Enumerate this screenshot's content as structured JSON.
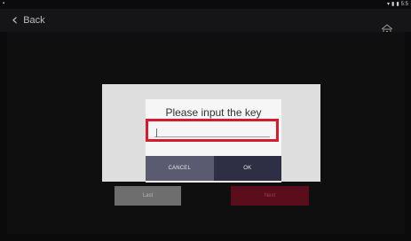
{
  "status_bar": {
    "left_icon": "notification-icon",
    "right_icons": [
      "wifi-icon",
      "signal-icon",
      "battery-icon"
    ],
    "time": "5:5"
  },
  "header": {
    "back_label": "Back",
    "back_icon": "chevron-left-icon",
    "home_icon": "home-icon"
  },
  "dialog": {
    "title": "Please input the key",
    "key_value": "",
    "cancel_label": "CANCEL",
    "ok_label": "OK",
    "highlight_color": "#d51b2d"
  },
  "navigation": {
    "last_label": "Last",
    "next_label": "Next"
  },
  "colors": {
    "background": "#0b0b0c",
    "cancel": "#5a5a70",
    "ok": "#2e2e44",
    "next": "#5a0e1c",
    "last": "#6e6e6e"
  }
}
